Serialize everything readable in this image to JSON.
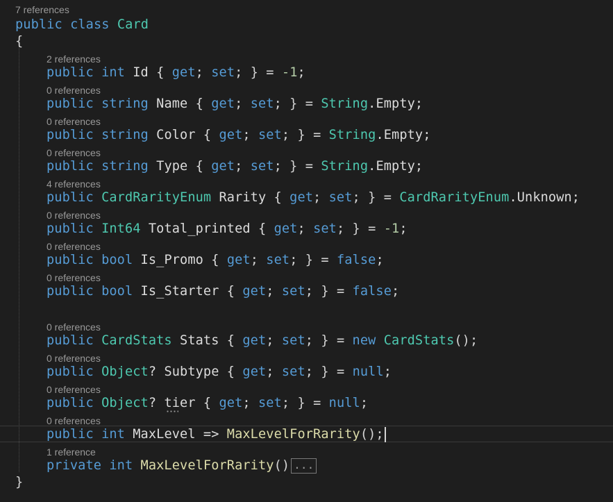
{
  "colors": {
    "background": "#1e1e1e",
    "keyword": "#569cd6",
    "type": "#4ec9b0",
    "identifier": "#dcdcdc",
    "number": "#b5cea8",
    "method": "#dcdcaa",
    "codelens": "#999999"
  },
  "lines": [
    {
      "kind": "lens",
      "text": "7 references"
    },
    {
      "kind": "code",
      "tokens": [
        {
          "t": "public",
          "c": "kw"
        },
        {
          "t": " ",
          "c": "pl"
        },
        {
          "t": "class",
          "c": "kw"
        },
        {
          "t": " ",
          "c": "pl"
        },
        {
          "t": "Card",
          "c": "ty"
        }
      ]
    },
    {
      "kind": "code",
      "tokens": [
        {
          "t": "{",
          "c": "pu"
        }
      ]
    },
    {
      "kind": "lens",
      "text": "2 references",
      "indent": true
    },
    {
      "kind": "code",
      "indent": true,
      "tokens": [
        {
          "t": "public",
          "c": "kw"
        },
        {
          "t": " ",
          "c": "pl"
        },
        {
          "t": "int",
          "c": "kw"
        },
        {
          "t": " Id { ",
          "c": "id"
        },
        {
          "t": "get",
          "c": "kw"
        },
        {
          "t": "; ",
          "c": "pu"
        },
        {
          "t": "set",
          "c": "kw"
        },
        {
          "t": "; } = ",
          "c": "pu"
        },
        {
          "t": "-1",
          "c": "nu"
        },
        {
          "t": ";",
          "c": "pu"
        }
      ]
    },
    {
      "kind": "lens",
      "text": "0 references",
      "indent": true
    },
    {
      "kind": "code",
      "indent": true,
      "tokens": [
        {
          "t": "public",
          "c": "kw"
        },
        {
          "t": " ",
          "c": "pl"
        },
        {
          "t": "string",
          "c": "kw"
        },
        {
          "t": " Name { ",
          "c": "id"
        },
        {
          "t": "get",
          "c": "kw"
        },
        {
          "t": "; ",
          "c": "pu"
        },
        {
          "t": "set",
          "c": "kw"
        },
        {
          "t": "; } = ",
          "c": "pu"
        },
        {
          "t": "String",
          "c": "ty"
        },
        {
          "t": ".Empty;",
          "c": "id"
        }
      ]
    },
    {
      "kind": "lens",
      "text": "0 references",
      "indent": true
    },
    {
      "kind": "code",
      "indent": true,
      "tokens": [
        {
          "t": "public",
          "c": "kw"
        },
        {
          "t": " ",
          "c": "pl"
        },
        {
          "t": "string",
          "c": "kw"
        },
        {
          "t": " Color { ",
          "c": "id"
        },
        {
          "t": "get",
          "c": "kw"
        },
        {
          "t": "; ",
          "c": "pu"
        },
        {
          "t": "set",
          "c": "kw"
        },
        {
          "t": "; } = ",
          "c": "pu"
        },
        {
          "t": "String",
          "c": "ty"
        },
        {
          "t": ".Empty;",
          "c": "id"
        }
      ]
    },
    {
      "kind": "lens",
      "text": "0 references",
      "indent": true
    },
    {
      "kind": "code",
      "indent": true,
      "tokens": [
        {
          "t": "public",
          "c": "kw"
        },
        {
          "t": " ",
          "c": "pl"
        },
        {
          "t": "string",
          "c": "kw"
        },
        {
          "t": " Type { ",
          "c": "id"
        },
        {
          "t": "get",
          "c": "kw"
        },
        {
          "t": "; ",
          "c": "pu"
        },
        {
          "t": "set",
          "c": "kw"
        },
        {
          "t": "; } = ",
          "c": "pu"
        },
        {
          "t": "String",
          "c": "ty"
        },
        {
          "t": ".Empty;",
          "c": "id"
        }
      ]
    },
    {
      "kind": "lens",
      "text": "4 references",
      "indent": true
    },
    {
      "kind": "code",
      "indent": true,
      "tokens": [
        {
          "t": "public",
          "c": "kw"
        },
        {
          "t": " ",
          "c": "pl"
        },
        {
          "t": "CardRarityEnum",
          "c": "ty"
        },
        {
          "t": " Rarity { ",
          "c": "id"
        },
        {
          "t": "get",
          "c": "kw"
        },
        {
          "t": "; ",
          "c": "pu"
        },
        {
          "t": "set",
          "c": "kw"
        },
        {
          "t": "; } = ",
          "c": "pu"
        },
        {
          "t": "CardRarityEnum",
          "c": "ty"
        },
        {
          "t": ".Unknown;",
          "c": "id"
        }
      ]
    },
    {
      "kind": "lens",
      "text": "0 references",
      "indent": true
    },
    {
      "kind": "code",
      "indent": true,
      "tokens": [
        {
          "t": "public",
          "c": "kw"
        },
        {
          "t": " ",
          "c": "pl"
        },
        {
          "t": "Int64",
          "c": "ty"
        },
        {
          "t": " Total_printed { ",
          "c": "id"
        },
        {
          "t": "get",
          "c": "kw"
        },
        {
          "t": "; ",
          "c": "pu"
        },
        {
          "t": "set",
          "c": "kw"
        },
        {
          "t": "; } = ",
          "c": "pu"
        },
        {
          "t": "-1",
          "c": "nu"
        },
        {
          "t": ";",
          "c": "pu"
        }
      ]
    },
    {
      "kind": "lens",
      "text": "0 references",
      "indent": true
    },
    {
      "kind": "code",
      "indent": true,
      "tokens": [
        {
          "t": "public",
          "c": "kw"
        },
        {
          "t": " ",
          "c": "pl"
        },
        {
          "t": "bool",
          "c": "kw"
        },
        {
          "t": " Is_Promo { ",
          "c": "id"
        },
        {
          "t": "get",
          "c": "kw"
        },
        {
          "t": "; ",
          "c": "pu"
        },
        {
          "t": "set",
          "c": "kw"
        },
        {
          "t": "; } = ",
          "c": "pu"
        },
        {
          "t": "false",
          "c": "kw"
        },
        {
          "t": ";",
          "c": "pu"
        }
      ]
    },
    {
      "kind": "lens",
      "text": "0 references",
      "indent": true
    },
    {
      "kind": "code",
      "indent": true,
      "tokens": [
        {
          "t": "public",
          "c": "kw"
        },
        {
          "t": " ",
          "c": "pl"
        },
        {
          "t": "bool",
          "c": "kw"
        },
        {
          "t": " Is_Starter { ",
          "c": "id"
        },
        {
          "t": "get",
          "c": "kw"
        },
        {
          "t": "; ",
          "c": "pu"
        },
        {
          "t": "set",
          "c": "kw"
        },
        {
          "t": "; } = ",
          "c": "pu"
        },
        {
          "t": "false",
          "c": "kw"
        },
        {
          "t": ";",
          "c": "pu"
        }
      ]
    },
    {
      "kind": "blank"
    },
    {
      "kind": "lens",
      "text": "0 references",
      "indent": true
    },
    {
      "kind": "code",
      "indent": true,
      "tokens": [
        {
          "t": "public",
          "c": "kw"
        },
        {
          "t": " ",
          "c": "pl"
        },
        {
          "t": "CardStats",
          "c": "ty"
        },
        {
          "t": " Stats { ",
          "c": "id"
        },
        {
          "t": "get",
          "c": "kw"
        },
        {
          "t": "; ",
          "c": "pu"
        },
        {
          "t": "set",
          "c": "kw"
        },
        {
          "t": "; } = ",
          "c": "pu"
        },
        {
          "t": "new",
          "c": "kw"
        },
        {
          "t": " ",
          "c": "pl"
        },
        {
          "t": "CardStats",
          "c": "ty"
        },
        {
          "t": "();",
          "c": "pu"
        }
      ]
    },
    {
      "kind": "lens",
      "text": "0 references",
      "indent": true
    },
    {
      "kind": "code",
      "indent": true,
      "tokens": [
        {
          "t": "public",
          "c": "kw"
        },
        {
          "t": " ",
          "c": "pl"
        },
        {
          "t": "Object",
          "c": "ty"
        },
        {
          "t": "? Subtype { ",
          "c": "id"
        },
        {
          "t": "get",
          "c": "kw"
        },
        {
          "t": "; ",
          "c": "pu"
        },
        {
          "t": "set",
          "c": "kw"
        },
        {
          "t": "; } = ",
          "c": "pu"
        },
        {
          "t": "null",
          "c": "kw"
        },
        {
          "t": ";",
          "c": "pu"
        }
      ]
    },
    {
      "kind": "lens",
      "text": "0 references",
      "indent": true
    },
    {
      "kind": "code",
      "indent": true,
      "tokens": [
        {
          "t": "public",
          "c": "kw"
        },
        {
          "t": " ",
          "c": "pl"
        },
        {
          "t": "Object",
          "c": "ty"
        },
        {
          "t": "? tier { ",
          "c": "id"
        },
        {
          "t": "get",
          "c": "kw"
        },
        {
          "t": "; ",
          "c": "pu"
        },
        {
          "t": "set",
          "c": "kw"
        },
        {
          "t": "; } = ",
          "c": "pu"
        },
        {
          "t": "null",
          "c": "kw"
        },
        {
          "t": ";",
          "c": "pu"
        }
      ]
    },
    {
      "kind": "lens",
      "text": "0 references",
      "indent": true
    },
    {
      "kind": "code",
      "indent": true,
      "tokens": [
        {
          "t": "public",
          "c": "kw"
        },
        {
          "t": " ",
          "c": "pl"
        },
        {
          "t": "int",
          "c": "kw"
        },
        {
          "t": " MaxLevel => ",
          "c": "id"
        },
        {
          "t": "MaxLevelForRarity",
          "c": "fn"
        },
        {
          "t": "();",
          "c": "pu"
        }
      ]
    },
    {
      "kind": "lens",
      "text": "1 reference",
      "indent": true
    },
    {
      "kind": "code",
      "indent": true,
      "collapsed": "...",
      "tokens": [
        {
          "t": "private",
          "c": "kw"
        },
        {
          "t": " ",
          "c": "pl"
        },
        {
          "t": "int",
          "c": "kw"
        },
        {
          "t": " ",
          "c": "pl"
        },
        {
          "t": "MaxLevelForRarity",
          "c": "fn"
        },
        {
          "t": "()",
          "c": "pu"
        }
      ]
    },
    {
      "kind": "code",
      "tokens": [
        {
          "t": "}",
          "c": "pu"
        }
      ]
    }
  ]
}
